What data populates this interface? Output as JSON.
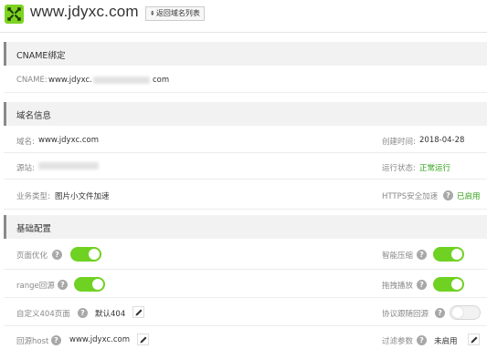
{
  "header": {
    "domain": "www.jdyxc.com",
    "back_label": "返回域名列表",
    "back_arrow": "⇞"
  },
  "cname_section": {
    "title": "CNAME绑定",
    "label": "CNAME:",
    "value_prefix": "www.jdyxc.",
    "value_suffix": "com"
  },
  "info_section": {
    "title": "域名信息",
    "domain_label": "域名:",
    "domain_value": "www.jdyxc.com",
    "created_label": "创建时间:",
    "created_value": "2018-04-28",
    "origin_label": "源站:",
    "status_label": "运行状态:",
    "status_value": "正常运行",
    "biz_label": "业务类型:",
    "biz_value": "图片小文件加速",
    "https_label": "HTTPS安全加速",
    "https_value": "已启用"
  },
  "config_section": {
    "title": "基础配置",
    "page_opt_label": "页面优化",
    "page_opt_on": true,
    "compress_label": "智能压缩",
    "compress_on": true,
    "range_label": "range回源",
    "range_on": true,
    "drag_label": "拖拽播放",
    "drag_on": true,
    "custom404_label": "自定义404页面",
    "custom404_value": "默认404",
    "protocol_label": "协议跟随回源",
    "protocol_on": false,
    "host_label": "回源host",
    "host_value": "www.jdyxc.com",
    "filter_label": "过滤参数",
    "filter_value": "未启用"
  },
  "icons": {
    "help": "?",
    "logo": "cross-arrows-icon",
    "edit": "pencil-icon"
  },
  "colors": {
    "accent_green": "#6fd222",
    "status_green": "#33a31b"
  }
}
